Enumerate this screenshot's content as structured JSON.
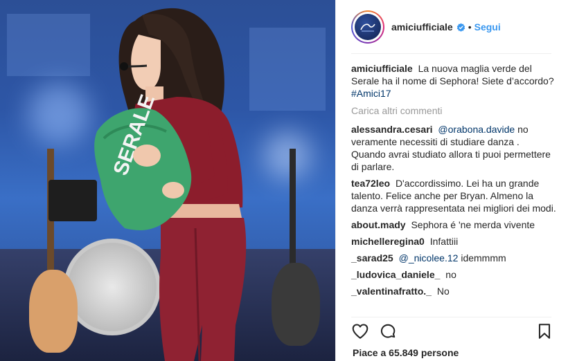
{
  "post": {
    "username": "amiciufficiale",
    "separator": "•",
    "follow_label": "Segui",
    "caption": {
      "username": "amiciufficiale",
      "text": "La nuova maglia verde del Serale ha il nome di Sephora! Siete d’accordo?",
      "hashtag": "#Amici17"
    },
    "load_more_label": "Carica altri commenti",
    "comments": [
      {
        "username": "alessandra.cesari",
        "mention": "@orabona.davide",
        "text": "no veramente necessiti di studiare danza . Quando avrai studiato allora ti puoi permettere di parlare."
      },
      {
        "username": "tea72leo",
        "mention": "",
        "text": "D'accordissimo. Lei ha un grande talento. Felice anche per Bryan. Almeno la danza verrà rappresentata nei migliori dei modi."
      },
      {
        "username": "about.mady",
        "mention": "",
        "text": "Sephora é 'ne merda vivente"
      },
      {
        "username": "michelleregina0",
        "mention": "",
        "text": "Infattiii"
      },
      {
        "username": "_sarad25",
        "mention": "@_nicolee.12",
        "text": "idemmmm"
      },
      {
        "username": "_ludovica_daniele_",
        "mention": "",
        "text": "no"
      },
      {
        "username": "_valentinafratto._",
        "mention": "",
        "text": "No"
      }
    ],
    "likes_text": "Piace a 65.849 persone",
    "shirt_text": "SERALE"
  },
  "icons": {
    "verified": "verified-badge-icon",
    "like": "heart-icon",
    "comment": "comment-bubble-icon",
    "save": "bookmark-icon"
  },
  "colors": {
    "link": "#3897f0",
    "mention": "#003569",
    "muted": "#999999",
    "text": "#262626"
  }
}
